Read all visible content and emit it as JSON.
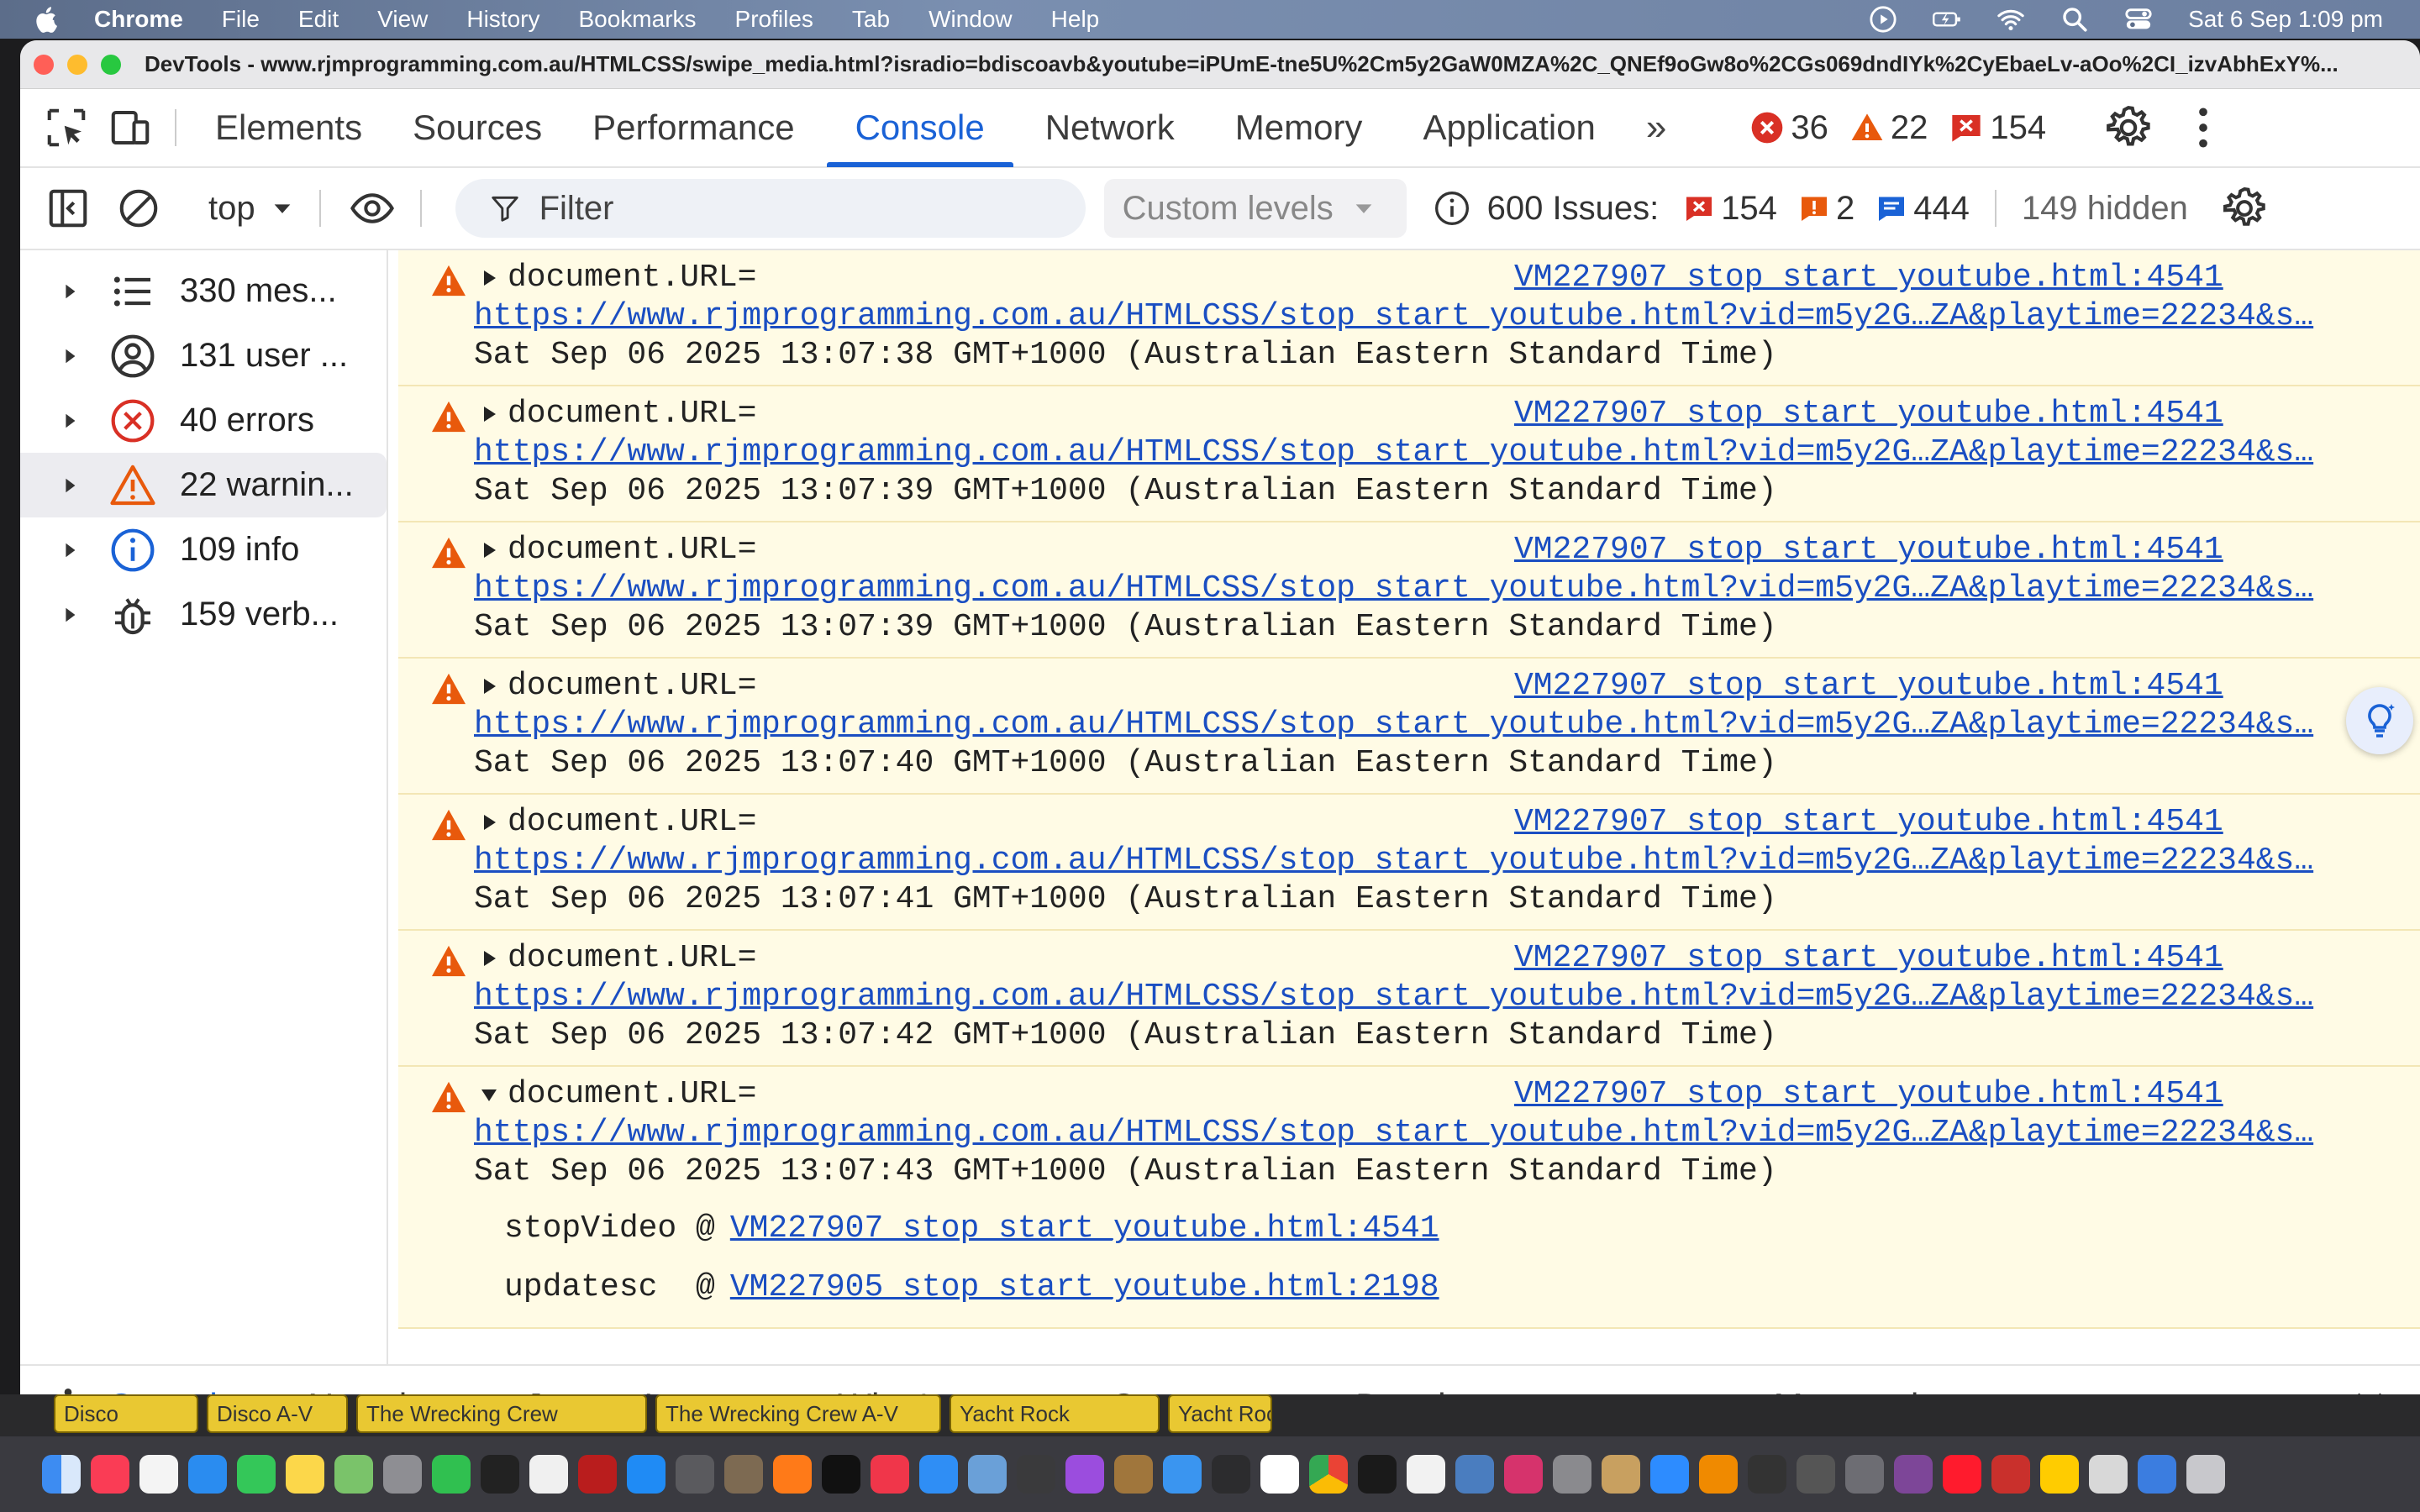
{
  "menubar": {
    "app": "Chrome",
    "items": [
      "File",
      "Edit",
      "View",
      "History",
      "Bookmarks",
      "Profiles",
      "Tab",
      "Window",
      "Help"
    ],
    "clock": "Sat 6 Sep  1:09 pm"
  },
  "window": {
    "title": "DevTools - www.rjmprogramming.com.au/HTMLCSS/swipe_media.html?isradio=bdiscoavb&youtube=iPUmE-tne5U%2Cm5y2GaW0MZA%2C_QNEf9oGw8o%2CGs069dndIYk%2CyEbaeLv-aOo%2CI_izvAbhExY%..."
  },
  "devtools_tabs": [
    "Elements",
    "Sources",
    "Performance",
    "Console",
    "Network",
    "Memory",
    "Application"
  ],
  "active_tab": "Console",
  "more_tabs": "»",
  "counters": {
    "errors": "36",
    "warnings": "22",
    "issues": "154"
  },
  "toolbar": {
    "context": "top",
    "filter_placeholder": "Filter",
    "levels": "Custom levels",
    "issues_label": "600 Issues:",
    "issue_errors": "154",
    "issue_warnings": "2",
    "issue_info": "444",
    "hidden": "149 hidden"
  },
  "sidebar": {
    "items": [
      {
        "label": "330 mes...",
        "icon": "list-icon"
      },
      {
        "label": "131 user ...",
        "icon": "user-icon"
      },
      {
        "label": "40 errors",
        "icon": "error-icon"
      },
      {
        "label": "22 warnin...",
        "icon": "warning-icon"
      },
      {
        "label": "109 info",
        "icon": "info-icon"
      },
      {
        "label": "159 verb...",
        "icon": "bug-icon"
      }
    ],
    "selected": 3
  },
  "messages": [
    {
      "text": "document.URL=",
      "source": "VM227907 stop_start_youtube.html:4541",
      "url": "https://www.rjmprogramming.com.au/HTMLCSS/stop_start_youtube.html?vid=m5y2G…ZA&playtime=22234&s…",
      "date": "Sat Sep 06 2025 13:07:38 GMT+1000 (Australian Eastern Standard Time)"
    },
    {
      "text": "document.URL=",
      "source": "VM227907 stop_start_youtube.html:4541",
      "url": "https://www.rjmprogramming.com.au/HTMLCSS/stop_start_youtube.html?vid=m5y2G…ZA&playtime=22234&s…",
      "date": "Sat Sep 06 2025 13:07:39 GMT+1000 (Australian Eastern Standard Time)"
    },
    {
      "text": "document.URL=",
      "source": "VM227907 stop_start_youtube.html:4541",
      "url": "https://www.rjmprogramming.com.au/HTMLCSS/stop_start_youtube.html?vid=m5y2G…ZA&playtime=22234&s…",
      "date": "Sat Sep 06 2025 13:07:39 GMT+1000 (Australian Eastern Standard Time)"
    },
    {
      "text": "document.URL=",
      "source": "VM227907 stop_start_youtube.html:4541",
      "url": "https://www.rjmprogramming.com.au/HTMLCSS/stop_start_youtube.html?vid=m5y2G…ZA&playtime=22234&s…",
      "date": "Sat Sep 06 2025 13:07:40 GMT+1000 (Australian Eastern Standard Time)"
    },
    {
      "text": "document.URL=",
      "source": "VM227907 stop_start_youtube.html:4541",
      "url": "https://www.rjmprogramming.com.au/HTMLCSS/stop_start_youtube.html?vid=m5y2G…ZA&playtime=22234&s…",
      "date": "Sat Sep 06 2025 13:07:41 GMT+1000 (Australian Eastern Standard Time)"
    },
    {
      "text": "document.URL=",
      "source": "VM227907 stop_start_youtube.html:4541",
      "url": "https://www.rjmprogramming.com.au/HTMLCSS/stop_start_youtube.html?vid=m5y2G…ZA&playtime=22234&s…",
      "date": "Sat Sep 06 2025 13:07:42 GMT+1000 (Australian Eastern Standard Time)"
    },
    {
      "text": "document.URL=",
      "source": "VM227907 stop_start_youtube.html:4541",
      "url": "https://www.rjmprogramming.com.au/HTMLCSS/stop_start_youtube.html?vid=m5y2G…ZA&playtime=22234&s…",
      "date": "Sat Sep 06 2025 13:07:43 GMT+1000 (Australian Eastern Standard Time)"
    }
  ],
  "stack": [
    {
      "fn": "stopVideo",
      "at": "@",
      "link": "VM227907 stop_start_youtube.html:4541"
    },
    {
      "fn": "updatesc",
      "at": "@",
      "link": "VM227905 stop_start_youtube.html:2198"
    }
  ],
  "drawer_tabs": [
    "Console",
    "AI assistance",
    "Issues",
    "What's new",
    "Coverage",
    "Developer resources",
    "Memory inspector"
  ],
  "page_chips": [
    "Disco",
    "Disco A-V",
    "The Wrecking Crew",
    "The Wrecking Crew A-V",
    "Yacht Rock",
    "Yacht Rock"
  ],
  "colors": {
    "accent": "#1a62d6",
    "warning_bg": "#fffbe5",
    "warning_icon": "#e8590c",
    "error": "#d93025",
    "link": "#1a4ec2"
  }
}
